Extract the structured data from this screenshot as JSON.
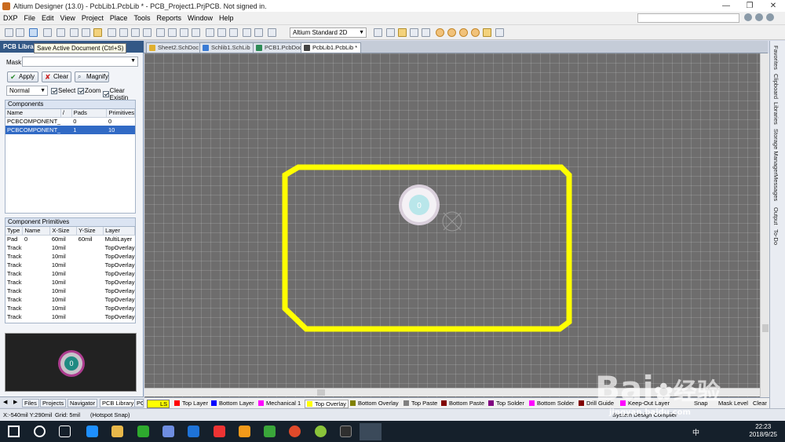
{
  "window": {
    "title": "Altium Designer (13.0) - PcbLib1.PcbLib * - PCB_Project1.PrjPCB. Not signed in.",
    "controls": [
      "—",
      "❐",
      "✕"
    ]
  },
  "menu": [
    "DXP",
    "File",
    "Edit",
    "View",
    "Project",
    "Place",
    "Tools",
    "Reports",
    "Window",
    "Help"
  ],
  "toolbar": {
    "view_mode": "Altium Standard 2D",
    "tooltip": "Save Active Document (Ctrl+S)"
  },
  "left_panel": {
    "title": "PCB Library",
    "mask_label": "Mask",
    "mask_value": "",
    "buttons": {
      "apply": "Apply",
      "clear": "Clear",
      "magnify": "Magnify"
    },
    "mode": "Normal",
    "checks": {
      "select": "Select",
      "zoom": "Zoom",
      "clear_existing": "Clear Existin"
    },
    "components": {
      "title": "Components",
      "headers": [
        "Name",
        "/",
        "Pads",
        "Primitives"
      ],
      "rows": [
        {
          "name": "PCBCOMPONENT_",
          "pads": "0",
          "primitives": "0",
          "selected": false
        },
        {
          "name": "PCBCOMPONENT_",
          "pads": "1",
          "primitives": "10",
          "selected": true
        }
      ]
    },
    "primitives": {
      "title": "Component Primitives",
      "headers": [
        "Type",
        "Name",
        "X-Size",
        "Y-Size",
        "Layer"
      ],
      "rows": [
        [
          "Pad",
          "0",
          "60mil",
          "60mil",
          "MultiLayer"
        ],
        [
          "Track",
          "",
          "10mil",
          "",
          "TopOverlay"
        ],
        [
          "Track",
          "",
          "10mil",
          "",
          "TopOverlay"
        ],
        [
          "Track",
          "",
          "10mil",
          "",
          "TopOverlay"
        ],
        [
          "Track",
          "",
          "10mil",
          "",
          "TopOverlay"
        ],
        [
          "Track",
          "",
          "10mil",
          "",
          "TopOverlay"
        ],
        [
          "Track",
          "",
          "10mil",
          "",
          "TopOverlay"
        ],
        [
          "Track",
          "",
          "10mil",
          "",
          "TopOverlay"
        ],
        [
          "Track",
          "",
          "10mil",
          "",
          "TopOverlay"
        ],
        [
          "Track",
          "",
          "10mil",
          "",
          "TopOverlay"
        ]
      ]
    },
    "preview_pad_label": "0",
    "bottom_tabs": [
      "Files",
      "Projects",
      "Navigator",
      "PCB Library",
      "PC"
    ]
  },
  "doc_tabs": [
    {
      "label": "Sheet2.SchDoc",
      "color": "#e0b030",
      "active": false
    },
    {
      "label": "Schlib1.SchLib",
      "color": "#3a7bd5",
      "active": false
    },
    {
      "label": "PCB1.PcbDoc",
      "color": "#2e8b57",
      "active": false
    },
    {
      "label": "PcbLib1.PcbLib *",
      "color": "#444444",
      "active": true
    }
  ],
  "canvas": {
    "pad_label": "0",
    "outline_color": "#ffff00",
    "background": "#6e6d6d"
  },
  "right_tabs": [
    "Favorites",
    "Clipboard",
    "Libraries",
    "Storage Manager",
    "Messages",
    "Output",
    "To-Do"
  ],
  "layers": [
    {
      "label": "LS",
      "color": "#ffff00",
      "active": false
    },
    {
      "label": "Top Layer",
      "color": "#ff0000",
      "active": false
    },
    {
      "label": "Bottom Layer",
      "color": "#0000ff",
      "active": false
    },
    {
      "label": "Mechanical 1",
      "color": "#ff00ff",
      "active": false
    },
    {
      "label": "Top Overlay",
      "color": "#ffff00",
      "active": true
    },
    {
      "label": "Bottom Overlay",
      "color": "#808000",
      "active": false
    },
    {
      "label": "Top Paste",
      "color": "#808080",
      "active": false
    },
    {
      "label": "Bottom Paste",
      "color": "#800000",
      "active": false
    },
    {
      "label": "Top Solder",
      "color": "#800080",
      "active": false
    },
    {
      "label": "Bottom Solder",
      "color": "#ff00ff",
      "active": false
    },
    {
      "label": "Drill Guide",
      "color": "#800000",
      "active": false
    },
    {
      "label": "Keep-Out Layer",
      "color": "#ff00ff",
      "active": false
    }
  ],
  "layer_bar_right": {
    "snap": "Snap",
    "mask_level": "Mask Level",
    "clear": "Clear"
  },
  "status": {
    "coords": "X:-540mil Y:290mil",
    "grid": "Grid: 5mil",
    "snap": "(Hotspot Snap)",
    "right": "System  Design Compiler"
  },
  "taskbar": {
    "time": "22:23",
    "date": "2018/9/25",
    "ime": "中",
    "icon_colors": [
      "#ffffff",
      "#1e90ff",
      "#e8b84a",
      "#2eaa2e",
      "#6e8de0",
      "#1e73d8",
      "#e33",
      "#f29a1a",
      "#3aa63a",
      "#e04a2a",
      "#8ac43a",
      "#2f2f2f",
      "#cccccc"
    ]
  },
  "watermark": {
    "brand": "Bai",
    "site": "jingyan.baidu.com",
    "cn": "经验"
  }
}
